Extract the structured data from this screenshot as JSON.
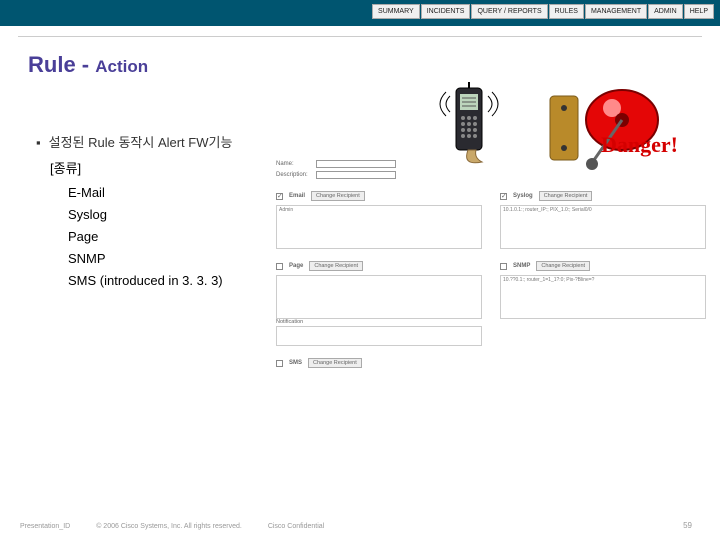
{
  "menu": [
    "SUMMARY",
    "INCIDENTS",
    "QUERY / REPORTS",
    "RULES",
    "MANAGEMENT",
    "ADMIN",
    "HELP"
  ],
  "title_main": "Rule - ",
  "title_sub": "Action",
  "bullet_text": "설정된 Rule 동작시 Alert FW기능",
  "category": "[종류]",
  "items": [
    "E-Mail",
    "Syslog",
    "Page",
    "SNMP",
    "SMS (introduced in 3. 3. 3)"
  ],
  "form": {
    "name_label": "Name:",
    "desc_label": "Description:"
  },
  "sections": {
    "email": {
      "label": "Email",
      "btn": "Change Recipient",
      "body": "Admin",
      "checked": true
    },
    "syslog": {
      "label": "Syslog",
      "btn": "Change Recipient",
      "body": "10.1.0.1:; router_IP:; PIX_1.0:; Serial0/0",
      "checked": true
    },
    "page": {
      "label": "Page",
      "btn": "Change Recipient",
      "notif_label": "Notification",
      "checked": false
    },
    "snmp": {
      "label": "SNMP",
      "btn": "Change Recipient",
      "body": "10.??0.1:; router_1=1_1?:0; Pix-?Bline=?",
      "checked": false
    },
    "sms": {
      "label": "SMS",
      "btn": "Change Recipient",
      "checked": false
    }
  },
  "clip": {
    "danger": "Danger!"
  },
  "footer": {
    "pid": "Presentation_ID",
    "copy": "© 2006 Cisco Systems, Inc. All rights reserved.",
    "conf": "Cisco Confidential"
  },
  "pagenum": "59"
}
